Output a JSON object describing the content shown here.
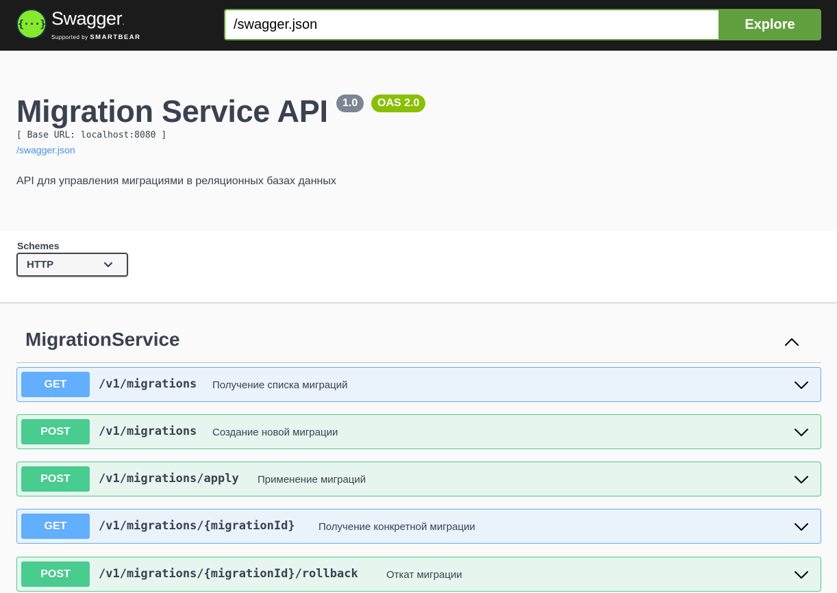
{
  "topbar": {
    "logo_title": "Swagger",
    "logo_sub_prefix": "Supported by",
    "logo_sub_brand": "SMARTBEAR",
    "url_value": "/swagger.json",
    "explore_label": "Explore",
    "accent_color": "#62a03f"
  },
  "info": {
    "title": "Migration Service API",
    "version": "1.0",
    "oas": "OAS 2.0",
    "base_url": "[ Base URL: localhost:8080 ]",
    "spec_link": "/swagger.json",
    "description": "API для управления миграциями в реляционных базах данных"
  },
  "schemes": {
    "label": "Schemes",
    "selected": "HTTP"
  },
  "tag": {
    "name": "MigrationService"
  },
  "operations": [
    {
      "method": "GET",
      "path": "/v1/migrations",
      "summary": "Получение списка миграций"
    },
    {
      "method": "POST",
      "path": "/v1/migrations",
      "summary": "Создание новой миграции"
    },
    {
      "method": "POST",
      "path": "/v1/migrations/apply",
      "summary": "Применение миграций"
    },
    {
      "method": "GET",
      "path": "/v1/migrations/{migrationId}",
      "summary": "Получение конкретной миграции"
    },
    {
      "method": "POST",
      "path": "/v1/migrations/{migrationId}/rollback",
      "summary": "Откат миграции"
    }
  ],
  "colors": {
    "get": "#61affe",
    "post": "#49cc90",
    "version_badge": "#7d8492",
    "oas_badge": "#89bf04"
  }
}
